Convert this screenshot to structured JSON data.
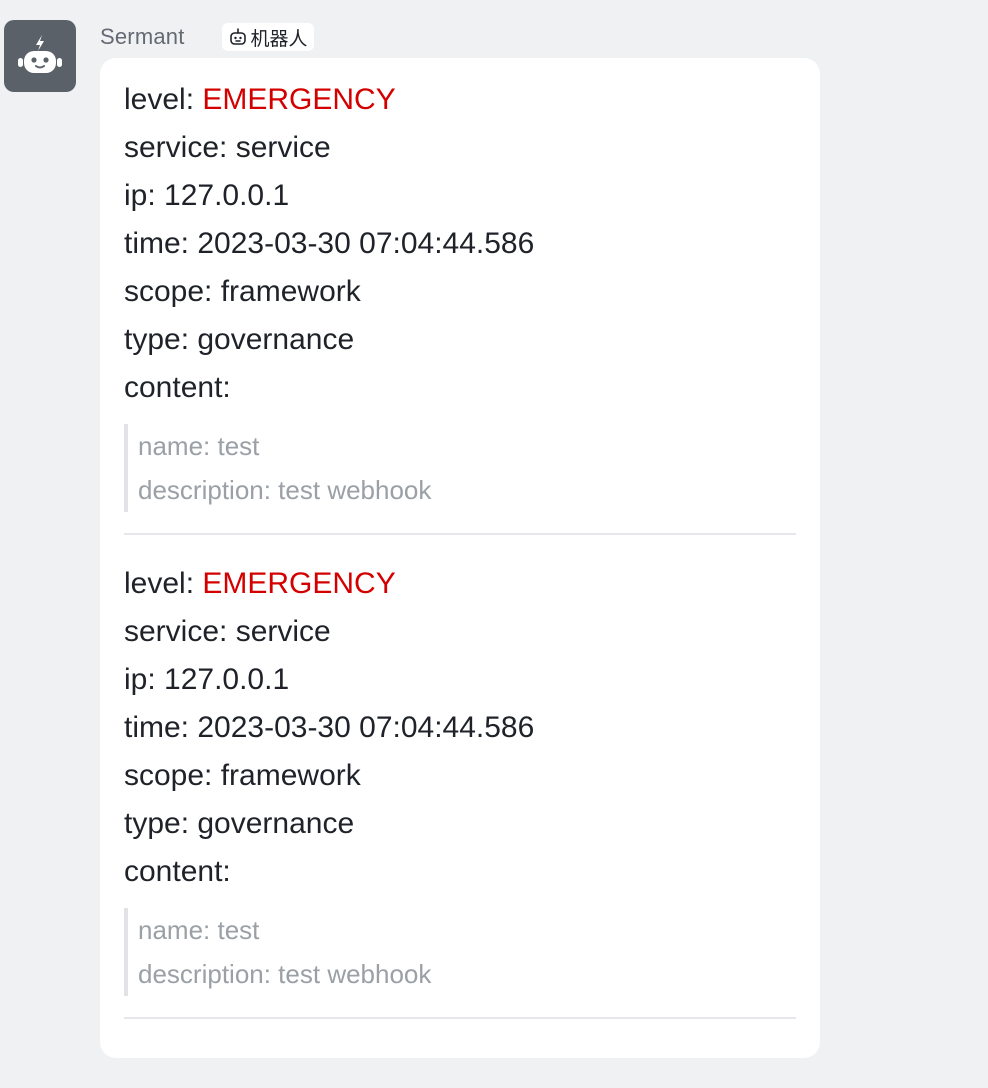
{
  "sender": {
    "name": "Sermant",
    "tag_label": "机器人",
    "avatar_icon": "robot-icon",
    "tag_icon": "robot-outline-icon"
  },
  "colors": {
    "emergency": "#d40000",
    "avatar_bg": "#5a6169",
    "page_bg": "#f0f1f3"
  },
  "messages": [
    {
      "level_key": "level: ",
      "level_value": "EMERGENCY",
      "service": "service: service",
      "ip": "ip: 127.0.0.1",
      "time": "time: 2023-03-30 07:04:44.586",
      "scope": "scope: framework",
      "type": "type: governance",
      "content_label": "content:",
      "content_name": "name: test",
      "content_description": "description: test webhook"
    },
    {
      "level_key": "level: ",
      "level_value": "EMERGENCY",
      "service": "service: service",
      "ip": "ip: 127.0.0.1",
      "time": "time: 2023-03-30 07:04:44.586",
      "scope": "scope: framework",
      "type": "type: governance",
      "content_label": "content:",
      "content_name": "name: test",
      "content_description": "description: test webhook"
    }
  ]
}
